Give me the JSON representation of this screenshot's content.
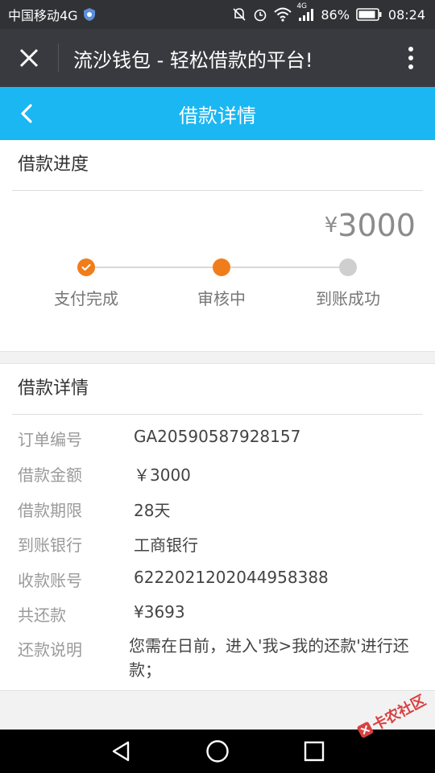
{
  "status_bar": {
    "carrier": "中国移动4G",
    "network_badge": "4G",
    "battery": "86%",
    "time": "08:24",
    "icons": [
      "shield-icon",
      "mute-icon",
      "alarm-icon",
      "wifi-icon",
      "signal-icon",
      "battery-icon"
    ]
  },
  "app_bar": {
    "title": "流沙钱包 - 轻松借款的平台!",
    "icons": [
      "close-icon",
      "more-vertical-icon"
    ]
  },
  "page_header": {
    "title": "借款详情",
    "icon": "back-arrow-icon"
  },
  "progress": {
    "section_title": "借款进度",
    "amount_symbol": "¥",
    "amount": "3000",
    "steps": [
      {
        "label": "支付完成",
        "state": "done"
      },
      {
        "label": "审核中",
        "state": "current"
      },
      {
        "label": "到账成功",
        "state": "pending"
      }
    ],
    "colors": {
      "active": "#f07d1b",
      "pending": "#cfcfcf",
      "header": "#1bb7f2"
    }
  },
  "details": {
    "section_title": "借款详情",
    "rows": [
      {
        "key": "订单编号",
        "value": "GA20590587928157"
      },
      {
        "key": "借款金额",
        "value": "￥3000"
      },
      {
        "key": "借款期限",
        "value": "28天"
      },
      {
        "key": "到账银行",
        "value": "工商银行"
      },
      {
        "key": "收款账号",
        "value": "6222021202044958388"
      },
      {
        "key": "共还款",
        "value": "¥3693"
      },
      {
        "key": "还款说明",
        "value": "您需在日前，进入'我>我的还款'进行还款；"
      }
    ]
  },
  "nav_bar": {
    "icons": [
      "nav-back-icon",
      "nav-home-icon",
      "nav-recents-icon"
    ]
  },
  "watermark": {
    "text": "卡农社区"
  }
}
